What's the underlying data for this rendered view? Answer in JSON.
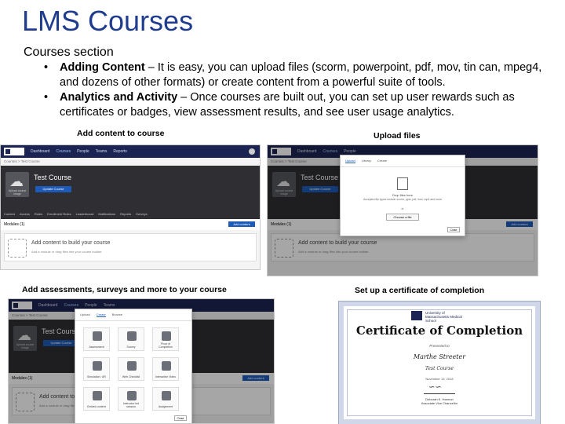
{
  "slide": {
    "title": "LMS Courses",
    "subtitle": "Courses section",
    "bullets": [
      {
        "bold": "Adding Content",
        "rest": " – It is easy, you can upload files (scorm, powerpoint, pdf, mov, tin can, mpeg4, and dozens of other formats) or create content from a powerful suite of tools."
      },
      {
        "bold": "Analytics and Activity",
        "rest": " – Once courses are built out, you can set up user rewards such as certificates or badges, view assessment results, and see user usage analytics."
      }
    ],
    "bullet_symbol": "•"
  },
  "captions": {
    "add_content": "Add content to course",
    "upload": "Upload files",
    "assessments": "Add assessments, surveys and more to your course",
    "certificate": "Set up a certificate of completion"
  },
  "lms": {
    "nav": [
      "Dashboard",
      "Courses",
      "People",
      "Teams",
      "Reports"
    ],
    "breadcrumb": "Courses > Test Course",
    "course_name": "Test Course",
    "hero_button": "Update Course",
    "cover_label": "Upload course image",
    "tabs": [
      "Content",
      "Access",
      "Rules",
      "Enrollment Rules",
      "Leaderboard",
      "Notifications",
      "Reports",
      "Surveys"
    ],
    "modules_label": "Modules (1)",
    "add_button": "Add content",
    "empty_title": "Add content to build your course",
    "empty_sub": "Add a module or drag files into your course builder."
  },
  "upload_modal": {
    "tabs": [
      "Upload",
      "Library",
      "Create"
    ],
    "drop_title": "Drop files here",
    "drop_sub": "Accepted file types include scorm, pptx, pdf, mov, mp4 and more",
    "or": "or",
    "choose": "Choose a file",
    "close": "Close"
  },
  "content_modal": {
    "tabs": [
      "Upload",
      "Create",
      "Browse"
    ],
    "tiles": [
      "Assessment",
      "Survey",
      "Proof of Completion",
      "Simulation / AR",
      "Web Checklist",
      "Interactive Video",
      "Embed content",
      "Instructor led session",
      "Assignment"
    ],
    "close": "Close"
  },
  "certificate": {
    "org": "University of Massachusetts Medical School",
    "title": "Certificate of Completion",
    "presented": "Presented to",
    "name": "Marthe Streeter",
    "course": "Test Course",
    "date": "November 13, 2018",
    "signer": "Deborah K. Harmon",
    "signer_role": "Associate Vice Chancellor"
  }
}
